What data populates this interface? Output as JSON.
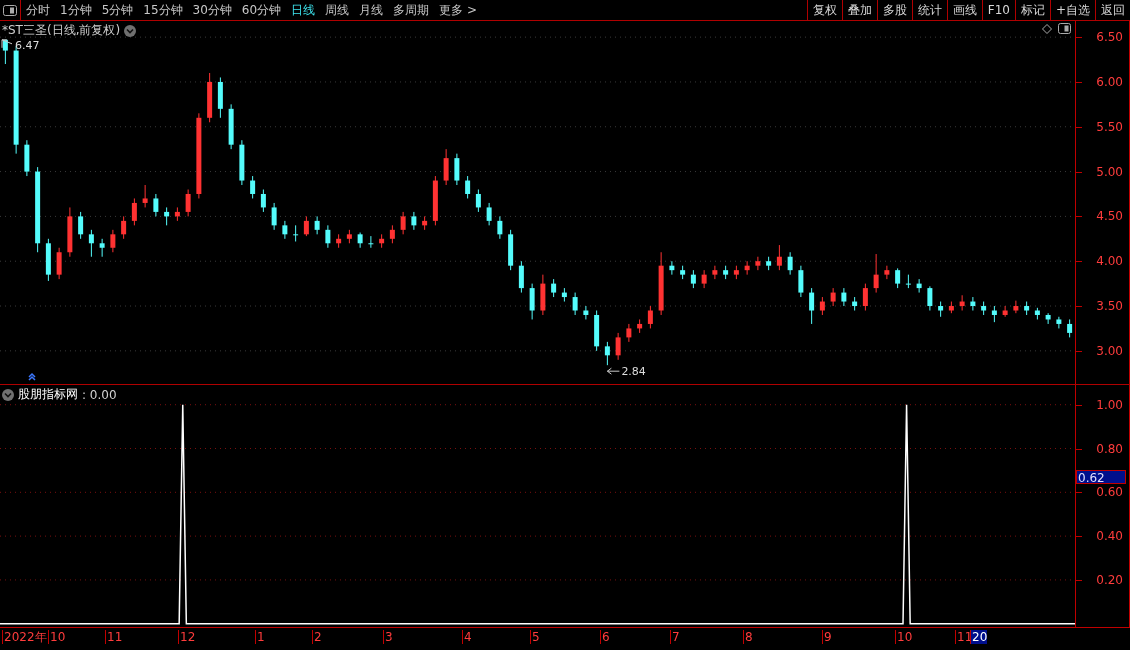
{
  "toolbar": {
    "periods": [
      {
        "label": "分时",
        "selected": false
      },
      {
        "label": "1分钟",
        "selected": false
      },
      {
        "label": "5分钟",
        "selected": false
      },
      {
        "label": "15分钟",
        "selected": false
      },
      {
        "label": "30分钟",
        "selected": false
      },
      {
        "label": "60分钟",
        "selected": false
      },
      {
        "label": "日线",
        "selected": true
      },
      {
        "label": "周线",
        "selected": false
      },
      {
        "label": "月线",
        "selected": false
      },
      {
        "label": "多周期",
        "selected": false
      },
      {
        "label": "更多 >",
        "selected": false
      }
    ],
    "buttons": [
      "复权",
      "叠加",
      "多股",
      "统计",
      "画线",
      "F10",
      "标记",
      "+自选",
      "返回"
    ]
  },
  "price_panel": {
    "title": "*ST三圣(日线,前复权)",
    "high_label": "6.47",
    "low_label": "2.84",
    "chart_data": {
      "type": "candlestick",
      "ylim": [
        2.63,
        6.68
      ],
      "grid": true,
      "yticks": [
        {
          "value": 6.5,
          "label": "6.50"
        },
        {
          "value": 6.0,
          "label": "6.00"
        },
        {
          "value": 5.5,
          "label": "5.50"
        },
        {
          "value": 5.0,
          "label": "5.00"
        },
        {
          "value": 4.5,
          "label": "4.50"
        },
        {
          "value": 4.0,
          "label": "4.00"
        },
        {
          "value": 3.5,
          "label": "3.50"
        },
        {
          "value": 3.0,
          "label": "3.00"
        }
      ],
      "categories": [
        null,
        null,
        null,
        null,
        null,
        null,
        null,
        null,
        null,
        null,
        null,
        null,
        null,
        null,
        null,
        null,
        null,
        null,
        null,
        null,
        null,
        null,
        null,
        null,
        null,
        null,
        null,
        null,
        null,
        null,
        null,
        null,
        null,
        null,
        null,
        null,
        null,
        null,
        null,
        null,
        null,
        null,
        null,
        null,
        null,
        null,
        null,
        null,
        null,
        null,
        null,
        null,
        null,
        null,
        null,
        null,
        null,
        null,
        null,
        null,
        null,
        null,
        null,
        null,
        null,
        null,
        null,
        null,
        null,
        null,
        null,
        null,
        null,
        null,
        null,
        null,
        null,
        null,
        null,
        null,
        null,
        null,
        null,
        null,
        null,
        null,
        null,
        null,
        null,
        null,
        null,
        null,
        null,
        null,
        null,
        null,
        null,
        null,
        null,
        null
      ],
      "ohlc": [
        [
          6.47,
          6.47,
          6.2,
          6.35
        ],
        [
          6.35,
          6.4,
          5.2,
          5.3
        ],
        [
          5.3,
          5.35,
          4.95,
          5.0
        ],
        [
          5.0,
          5.05,
          4.1,
          4.2
        ],
        [
          4.2,
          4.25,
          3.78,
          3.85
        ],
        [
          3.85,
          4.15,
          3.8,
          4.1
        ],
        [
          4.1,
          4.6,
          4.05,
          4.5
        ],
        [
          4.5,
          4.55,
          4.25,
          4.3
        ],
        [
          4.3,
          4.35,
          4.05,
          4.2
        ],
        [
          4.2,
          4.25,
          4.05,
          4.15
        ],
        [
          4.15,
          4.35,
          4.1,
          4.3
        ],
        [
          4.3,
          4.5,
          4.25,
          4.45
        ],
        [
          4.45,
          4.7,
          4.4,
          4.65
        ],
        [
          4.65,
          4.85,
          4.6,
          4.7
        ],
        [
          4.7,
          4.75,
          4.5,
          4.55
        ],
        [
          4.55,
          4.6,
          4.4,
          4.5
        ],
        [
          4.5,
          4.6,
          4.45,
          4.55
        ],
        [
          4.55,
          4.8,
          4.5,
          4.75
        ],
        [
          4.75,
          5.65,
          4.7,
          5.6
        ],
        [
          5.6,
          6.1,
          5.55,
          6.0
        ],
        [
          6.0,
          6.05,
          5.6,
          5.7
        ],
        [
          5.7,
          5.75,
          5.25,
          5.3
        ],
        [
          5.3,
          5.35,
          4.85,
          4.9
        ],
        [
          4.9,
          4.95,
          4.7,
          4.75
        ],
        [
          4.75,
          4.8,
          4.55,
          4.6
        ],
        [
          4.6,
          4.65,
          4.35,
          4.4
        ],
        [
          4.4,
          4.45,
          4.25,
          4.3
        ],
        [
          4.3,
          4.4,
          4.22,
          4.3
        ],
        [
          4.3,
          4.5,
          4.28,
          4.45
        ],
        [
          4.45,
          4.5,
          4.3,
          4.35
        ],
        [
          4.35,
          4.4,
          4.15,
          4.2
        ],
        [
          4.2,
          4.3,
          4.15,
          4.25
        ],
        [
          4.25,
          4.35,
          4.2,
          4.3
        ],
        [
          4.3,
          4.32,
          4.15,
          4.2
        ],
        [
          4.2,
          4.28,
          4.15,
          4.2
        ],
        [
          4.2,
          4.3,
          4.15,
          4.25
        ],
        [
          4.25,
          4.4,
          4.2,
          4.35
        ],
        [
          4.35,
          4.55,
          4.3,
          4.5
        ],
        [
          4.5,
          4.55,
          4.35,
          4.4
        ],
        [
          4.4,
          4.5,
          4.35,
          4.45
        ],
        [
          4.45,
          4.95,
          4.4,
          4.9
        ],
        [
          4.9,
          5.25,
          4.85,
          5.15
        ],
        [
          5.15,
          5.2,
          4.85,
          4.9
        ],
        [
          4.9,
          4.95,
          4.7,
          4.75
        ],
        [
          4.75,
          4.8,
          4.55,
          4.6
        ],
        [
          4.6,
          4.65,
          4.4,
          4.45
        ],
        [
          4.45,
          4.5,
          4.25,
          4.3
        ],
        [
          4.3,
          4.35,
          3.9,
          3.95
        ],
        [
          3.95,
          4.0,
          3.65,
          3.7
        ],
        [
          3.7,
          3.75,
          3.35,
          3.45
        ],
        [
          3.45,
          3.85,
          3.4,
          3.75
        ],
        [
          3.75,
          3.8,
          3.6,
          3.65
        ],
        [
          3.65,
          3.7,
          3.55,
          3.6
        ],
        [
          3.6,
          3.65,
          3.4,
          3.45
        ],
        [
          3.45,
          3.5,
          3.35,
          3.4
        ],
        [
          3.4,
          3.45,
          3.0,
          3.05
        ],
        [
          3.05,
          3.1,
          2.84,
          2.95
        ],
        [
          2.95,
          3.2,
          2.9,
          3.15
        ],
        [
          3.15,
          3.3,
          3.1,
          3.25
        ],
        [
          3.25,
          3.35,
          3.2,
          3.3
        ],
        [
          3.3,
          3.5,
          3.25,
          3.45
        ],
        [
          3.45,
          4.1,
          3.4,
          3.95
        ],
        [
          3.95,
          4.0,
          3.85,
          3.9
        ],
        [
          3.9,
          3.95,
          3.8,
          3.85
        ],
        [
          3.85,
          3.9,
          3.7,
          3.75
        ],
        [
          3.75,
          3.9,
          3.7,
          3.85
        ],
        [
          3.85,
          3.95,
          3.8,
          3.9
        ],
        [
          3.9,
          3.95,
          3.8,
          3.85
        ],
        [
          3.85,
          3.95,
          3.8,
          3.9
        ],
        [
          3.9,
          4.0,
          3.85,
          3.95
        ],
        [
          3.95,
          4.05,
          3.9,
          4.0
        ],
        [
          4.0,
          4.05,
          3.9,
          3.95
        ],
        [
          3.95,
          4.18,
          3.9,
          4.05
        ],
        [
          4.05,
          4.1,
          3.85,
          3.9
        ],
        [
          3.9,
          3.95,
          3.6,
          3.65
        ],
        [
          3.65,
          3.7,
          3.3,
          3.45
        ],
        [
          3.45,
          3.6,
          3.4,
          3.55
        ],
        [
          3.55,
          3.7,
          3.5,
          3.65
        ],
        [
          3.65,
          3.7,
          3.5,
          3.55
        ],
        [
          3.55,
          3.6,
          3.45,
          3.5
        ],
        [
          3.5,
          3.75,
          3.45,
          3.7
        ],
        [
          3.7,
          4.08,
          3.65,
          3.85
        ],
        [
          3.85,
          3.95,
          3.8,
          3.9
        ],
        [
          3.9,
          3.92,
          3.7,
          3.75
        ],
        [
          3.75,
          3.85,
          3.7,
          3.75
        ],
        [
          3.75,
          3.8,
          3.65,
          3.7
        ],
        [
          3.7,
          3.72,
          3.45,
          3.5
        ],
        [
          3.5,
          3.55,
          3.38,
          3.45
        ],
        [
          3.45,
          3.55,
          3.42,
          3.5
        ],
        [
          3.5,
          3.62,
          3.45,
          3.55
        ],
        [
          3.55,
          3.6,
          3.45,
          3.5
        ],
        [
          3.5,
          3.55,
          3.4,
          3.45
        ],
        [
          3.45,
          3.5,
          3.32,
          3.4
        ],
        [
          3.4,
          3.5,
          3.38,
          3.45
        ],
        [
          3.45,
          3.56,
          3.42,
          3.5
        ],
        [
          3.5,
          3.55,
          3.4,
          3.45
        ],
        [
          3.45,
          3.48,
          3.35,
          3.4
        ],
        [
          3.4,
          3.42,
          3.3,
          3.35
        ],
        [
          3.35,
          3.38,
          3.25,
          3.3
        ],
        [
          3.3,
          3.35,
          3.15,
          3.2
        ]
      ]
    }
  },
  "indicator_panel": {
    "reading": ": 0.00",
    "cursor_value": "0.62",
    "chart_data": {
      "type": "line",
      "ylim": [
        -0.015,
        1.09
      ],
      "grid": true,
      "categories": [
        null,
        null,
        null,
        null,
        null,
        null,
        null,
        null,
        null,
        null,
        null,
        null,
        null,
        null,
        null,
        null,
        null,
        null,
        null,
        null,
        null,
        null,
        null,
        null,
        null,
        null,
        null,
        null,
        null,
        null,
        null,
        null,
        null,
        null,
        null,
        null,
        null,
        null,
        null,
        null,
        null,
        null,
        null,
        null,
        null,
        null,
        null,
        null,
        null,
        null,
        null,
        null,
        null,
        null,
        null,
        null,
        null,
        null,
        null,
        null,
        null,
        null,
        null,
        null,
        null,
        null,
        null,
        null,
        null,
        null,
        null,
        null,
        null,
        null,
        null,
        null,
        null,
        null,
        null,
        null,
        null,
        null,
        null,
        null,
        null,
        null,
        null,
        null,
        null,
        null,
        null,
        null,
        null,
        null,
        null,
        null,
        null,
        null,
        null,
        null,
        null,
        null,
        null,
        null,
        null,
        null,
        null,
        null,
        null,
        null,
        null,
        null,
        null,
        null,
        null,
        null,
        null,
        null,
        null,
        null,
        null,
        null,
        null,
        null,
        null,
        null,
        null,
        null,
        null,
        null,
        null,
        null,
        null,
        null,
        null,
        null,
        null,
        null,
        null,
        null,
        null,
        null,
        null,
        null,
        null,
        null,
        null,
        null,
        null,
        null,
        null,
        null,
        null,
        null,
        null,
        null,
        null,
        null,
        null,
        null,
        null,
        null,
        null,
        null,
        null,
        null,
        null,
        null,
        null,
        null,
        null,
        null,
        null,
        null,
        null,
        null,
        null,
        null,
        null,
        null,
        null,
        null,
        null,
        null,
        null,
        null,
        null,
        null,
        null,
        null,
        null,
        null,
        null,
        null,
        null,
        null,
        null,
        null,
        null,
        null,
        null,
        null,
        null,
        null,
        null,
        null,
        null,
        null,
        null,
        null,
        null,
        null,
        null,
        null,
        null,
        null,
        null,
        null,
        null,
        null,
        null,
        null,
        null,
        null,
        null,
        null,
        null,
        null,
        null,
        null,
        null,
        null,
        null,
        null,
        null,
        null,
        null,
        null,
        null,
        null,
        null,
        null,
        null,
        null,
        null,
        null,
        null,
        null,
        null,
        null,
        null,
        null,
        null,
        null,
        null,
        null,
        null,
        null,
        null,
        null,
        null,
        null,
        null,
        null,
        null,
        null,
        null,
        null,
        null,
        null,
        null,
        null,
        null,
        null,
        null,
        null,
        null,
        null,
        null,
        null,
        null,
        null,
        null,
        null,
        null,
        null,
        null,
        null,
        null,
        null,
        null,
        null,
        null,
        null,
        null,
        null,
        null,
        null,
        null,
        null,
        null
      ],
      "yticks": [
        {
          "value": 0.2,
          "label": "0.20"
        },
        {
          "value": 0.4,
          "label": "0.40"
        },
        {
          "value": 0.6,
          "label": "0.60"
        },
        {
          "value": 0.8,
          "label": "0.80"
        },
        {
          "value": 1.0,
          "label": "1.00"
        }
      ],
      "series": [
        {
          "name": "股朋指标网",
          "color": "#ffffff",
          "values": [
            0,
            0,
            0,
            0,
            0,
            0,
            0,
            0,
            0,
            0,
            0,
            0,
            0,
            0,
            0,
            0,
            0,
            0,
            0,
            0,
            0,
            0,
            0,
            0,
            0,
            0,
            0,
            0,
            0,
            0,
            0,
            0,
            0,
            0,
            0,
            0,
            0,
            0,
            0,
            0,
            0,
            0,
            0,
            0,
            0,
            0,
            0,
            0,
            0,
            0,
            0,
            1,
            0,
            0,
            0,
            0,
            0,
            0,
            0,
            0,
            0,
            0,
            0,
            0,
            0,
            0,
            0,
            0,
            0,
            0,
            0,
            0,
            0,
            0,
            0,
            0,
            0,
            0,
            0,
            0,
            0,
            0,
            0,
            0,
            0,
            0,
            0,
            0,
            0,
            0,
            0,
            0,
            0,
            0,
            0,
            0,
            0,
            0,
            0,
            0,
            0,
            0,
            0,
            0,
            0,
            0,
            0,
            0,
            0,
            0,
            0,
            0,
            0,
            0,
            0,
            0,
            0,
            0,
            0,
            0,
            0,
            0,
            0,
            0,
            0,
            0,
            0,
            0,
            0,
            0,
            0,
            0,
            0,
            0,
            0,
            0,
            0,
            0,
            0,
            0,
            0,
            0,
            0,
            0,
            0,
            0,
            0,
            0,
            0,
            0,
            0,
            0,
            0,
            0,
            0,
            0,
            0,
            0,
            0,
            0,
            0,
            0,
            0,
            0,
            0,
            0,
            0,
            0,
            0,
            0,
            0,
            0,
            0,
            0,
            0,
            0,
            0,
            0,
            0,
            0,
            0,
            0,
            0,
            0,
            0,
            0,
            0,
            0,
            0,
            0,
            0,
            0,
            0,
            0,
            0,
            0,
            0,
            0,
            0,
            0,
            0,
            0,
            0,
            0,
            0,
            0,
            0,
            0,
            0,
            0,
            0,
            0,
            0,
            0,
            0,
            0,
            0,
            0,
            0,
            0,
            0,
            0,
            0,
            0,
            0,
            0,
            0,
            0,
            0,
            0,
            0,
            0,
            0,
            0,
            0,
            0,
            0,
            0,
            0,
            0,
            0,
            0,
            0,
            0,
            0,
            0,
            0,
            0,
            0,
            0,
            0,
            0,
            0,
            1,
            0,
            0,
            0,
            0,
            0,
            0,
            0,
            0,
            0,
            0,
            0,
            0,
            0,
            0,
            0,
            0,
            0,
            0,
            0,
            0,
            0,
            0,
            0,
            0,
            0,
            0,
            0,
            0,
            0,
            0,
            0,
            0,
            0,
            0,
            0,
            0,
            0,
            0,
            0,
            0,
            0,
            0,
            0,
            0,
            0,
            0,
            0
          ]
        }
      ]
    }
  },
  "date_axis": [
    {
      "label": "2022年",
      "selected": false
    },
    {
      "label": "10",
      "selected": false
    },
    {
      "label": "11",
      "selected": false
    },
    {
      "label": "12",
      "selected": false
    },
    {
      "label": "1",
      "selected": false
    },
    {
      "label": "2",
      "selected": false
    },
    {
      "label": "3",
      "selected": false
    },
    {
      "label": "4",
      "selected": false
    },
    {
      "label": "5",
      "selected": false
    },
    {
      "label": "6",
      "selected": false
    },
    {
      "label": "7",
      "selected": false
    },
    {
      "label": "8",
      "selected": false
    },
    {
      "label": "9",
      "selected": false
    },
    {
      "label": "10",
      "selected": false
    },
    {
      "label": "11",
      "selected": false
    },
    {
      "label": "20",
      "selected": true
    }
  ]
}
